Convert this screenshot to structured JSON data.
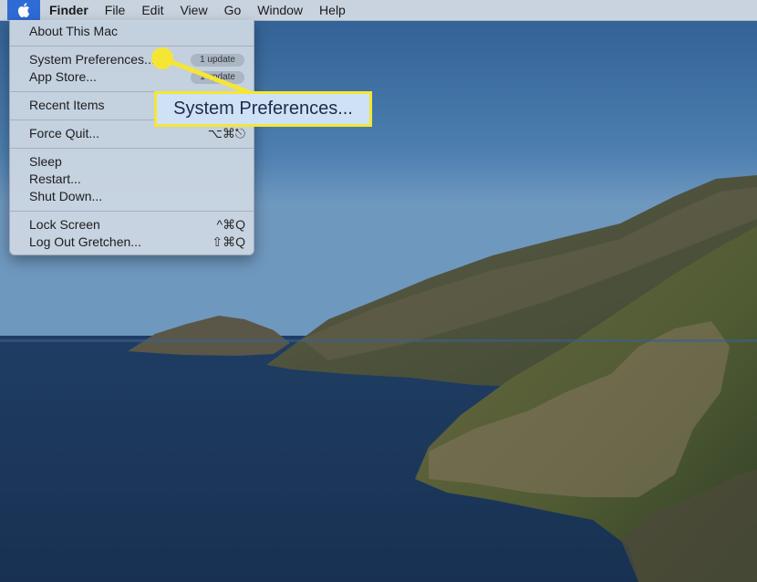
{
  "menubar": {
    "apple_icon": "apple-logo-icon",
    "app_name": "Finder",
    "menus": [
      "File",
      "Edit",
      "View",
      "Go",
      "Window",
      "Help"
    ]
  },
  "apple_menu": {
    "about": "About This Mac",
    "system_preferences": "System Preferences...",
    "system_preferences_badge": "1 update",
    "app_store": "App Store...",
    "app_store_badge": "1 update",
    "recent_items": "Recent Items",
    "force_quit": "Force Quit...",
    "force_quit_shortcut": "⌥⌘⎋",
    "sleep": "Sleep",
    "restart": "Restart...",
    "shut_down": "Shut Down...",
    "lock_screen": "Lock Screen",
    "lock_screen_shortcut": "^⌘Q",
    "log_out": "Log Out Gretchen...",
    "log_out_shortcut": "⇧⌘Q"
  },
  "callout": {
    "label": "System Preferences...",
    "color": "#f5e634"
  },
  "colors": {
    "menu_highlight": "#2f6bd4",
    "callout": "#f5e634"
  }
}
